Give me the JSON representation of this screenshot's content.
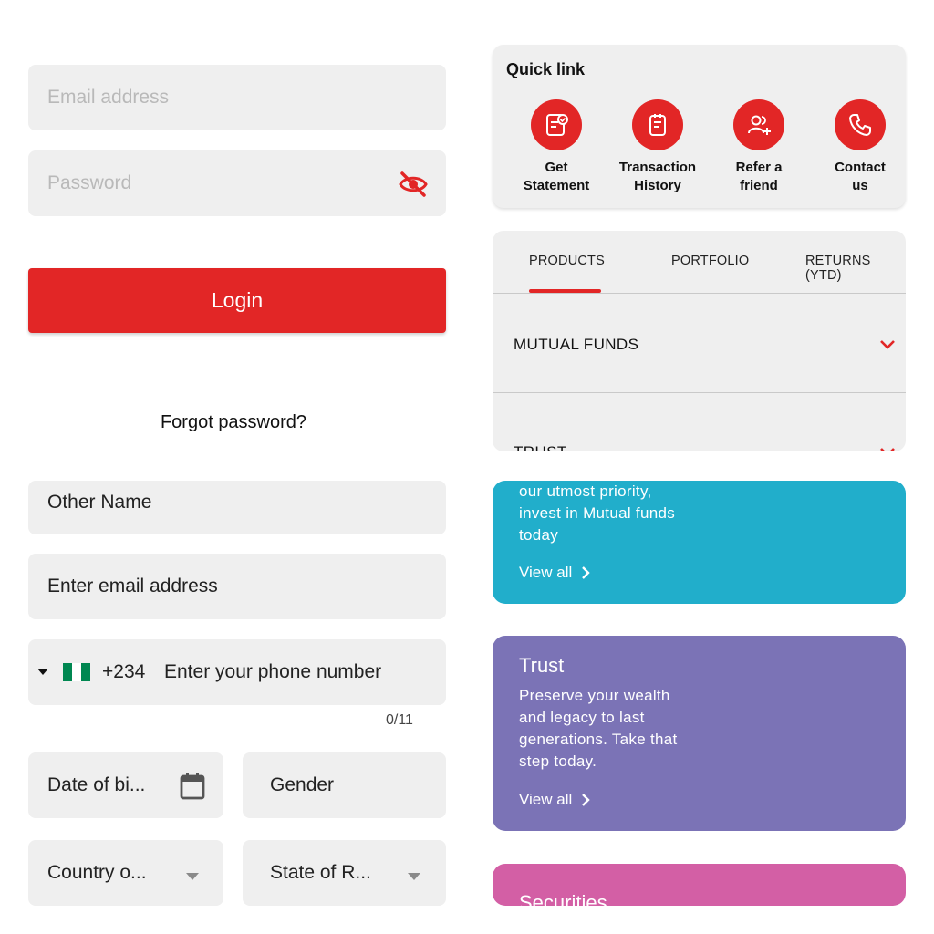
{
  "login": {
    "email_placeholder": "Email address",
    "password_placeholder": "Password",
    "login_label": "Login",
    "forgot_label": "Forgot password?"
  },
  "quick_links": {
    "title": "Quick link",
    "items": [
      {
        "label_1": "Get",
        "label_2": "Statement",
        "icon": "statement-icon"
      },
      {
        "label_1": "Transaction",
        "label_2": "History",
        "icon": "receipt-icon"
      },
      {
        "label_1": "Refer a",
        "label_2": "friend",
        "icon": "add-user-icon"
      },
      {
        "label_1": "Contact",
        "label_2": "us",
        "icon": "phone-icon"
      }
    ]
  },
  "tabs": {
    "items": [
      "PRODUCTS",
      "PORTFOLIO",
      "RETURNS (YTD)"
    ],
    "active": 0,
    "accordion": [
      "MUTUAL FUNDS",
      "TRUST"
    ]
  },
  "promos": {
    "mutual": {
      "text_1": "our utmost priority,",
      "text_2": "invest in Mutual funds",
      "text_3": "today",
      "view_all": "View all",
      "color": "#21aecb"
    },
    "trust": {
      "title": "Trust",
      "text_1": "Preserve your wealth",
      "text_2": "and legacy to last",
      "text_3": "generations. Take that",
      "text_4": "step today.",
      "view_all": "View all",
      "color": "#7b73b6"
    },
    "securities": {
      "title": "Securities",
      "color": "#d35fa5"
    }
  },
  "register": {
    "other_name": "Other Name",
    "email": "Enter email address",
    "flag": "🇳🇬",
    "dial_code": "+234",
    "phone_placeholder": "Enter your phone number",
    "phone_counter": "0/11",
    "dob": "Date of bi...",
    "gender": "Gender",
    "country": "Country o...",
    "state": "State of R..."
  },
  "colors": {
    "accent": "#e22626"
  }
}
